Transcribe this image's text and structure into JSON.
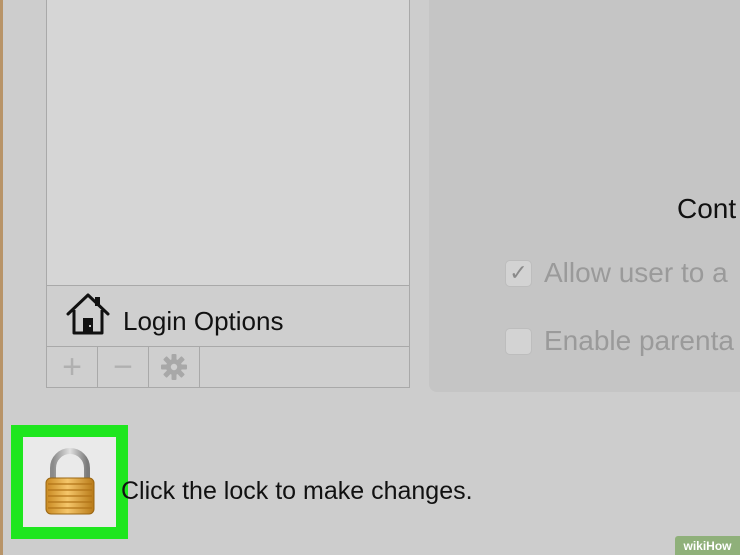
{
  "sidebar": {
    "login_options_label": "Login Options",
    "add_button": "+",
    "remove_button": "−"
  },
  "panel": {
    "heading_partial": "Cont",
    "allow_user_label": "Allow user to a",
    "allow_user_checked": true,
    "enable_parental_label": "Enable parenta",
    "enable_parental_checked": false
  },
  "lock": {
    "message": "Click the lock to make changes.",
    "highlight_color": "#1ee61e",
    "state": "locked"
  },
  "watermark": {
    "text": "wikiHow"
  },
  "icons": {
    "house": "house-icon",
    "gear": "gear-icon",
    "lock": "lock-icon",
    "check": "checkmark-icon"
  }
}
